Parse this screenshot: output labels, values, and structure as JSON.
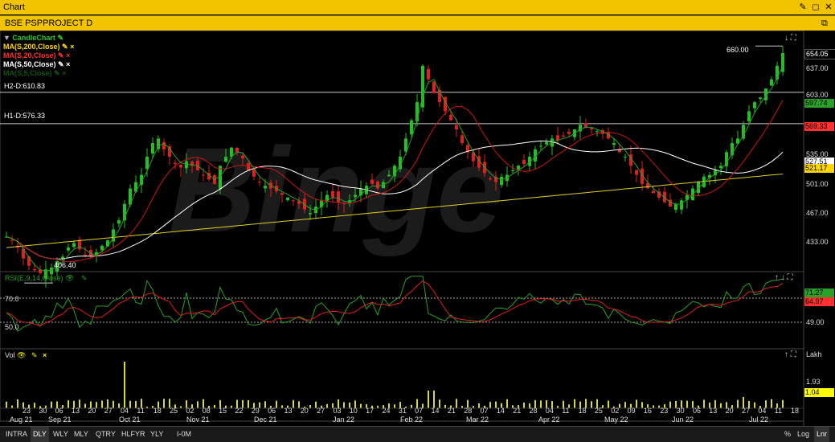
{
  "window": {
    "title": "Chart",
    "controls": [
      "✎",
      "◻",
      "✕"
    ]
  },
  "chart_header": {
    "symbol": "BSE PSPPROJECT D",
    "restore_icon": "⧉"
  },
  "legend": [
    {
      "label": "CandleChart",
      "color": "#2ecc2e"
    },
    {
      "label": "MA(S,200,Close)",
      "color": "#ffd700"
    },
    {
      "label": "MA(S,20,Close)",
      "color": "#ff3030"
    },
    {
      "label": "MA(S,50,Close)",
      "color": "#ffffff"
    },
    {
      "label": "MA(S,5,Close)",
      "color": "#2aa02a"
    }
  ],
  "price_panel": {
    "h2_label": "H2-D:610.83",
    "h1_label": "H1-D:576.33",
    "low_label": "406.40",
    "high_label": "660.00",
    "watermark": "Binge",
    "y_ticks": [
      "637.00",
      "603.00",
      "535.00",
      "501.00",
      "467.00",
      "433.00"
    ],
    "price_boxes": [
      {
        "text": "654.05",
        "color": "#ffffff",
        "bg": "#000000"
      },
      {
        "text": "597.74",
        "color": "#000000",
        "bg": "#2aa02a"
      },
      {
        "text": "569.33",
        "color": "#000000",
        "bg": "#ff3030"
      },
      {
        "text": "527.51",
        "color": "#000000",
        "bg": "#ffffff"
      },
      {
        "text": "521.17",
        "color": "#000000",
        "bg": "#ffd700"
      }
    ]
  },
  "rsi_panel": {
    "label": "RSI(E,9,14,Close)",
    "levels": [
      "70.0",
      "50.0"
    ],
    "y_tick": "49.00",
    "boxes": [
      {
        "text": "71.27",
        "color": "#000000",
        "bg": "#2aa02a"
      },
      {
        "text": "64.97",
        "color": "#000000",
        "bg": "#ff3030"
      }
    ]
  },
  "vol_panel": {
    "label": "Vol",
    "unit": "Lakh",
    "y_tick": "1.93",
    "box": {
      "text": "1.04",
      "color": "#000000",
      "bg": "#ffff00"
    }
  },
  "x_axis": {
    "days": [
      "23",
      "30",
      "06",
      "13",
      "20",
      "27",
      "04",
      "11",
      "18",
      "25",
      "02",
      "08",
      "15",
      "22",
      "29",
      "06",
      "13",
      "20",
      "27",
      "03",
      "10",
      "17",
      "24",
      "31",
      "07",
      "14",
      "21",
      "28",
      "07",
      "14",
      "21",
      "28",
      "04",
      "11",
      "18",
      "25",
      "02",
      "09",
      "16",
      "23",
      "30",
      "06",
      "13",
      "20",
      "27",
      "04",
      "11",
      "18"
    ],
    "months": [
      "Aug 21",
      "Sep 21",
      "Oct 21",
      "Nov 21",
      "Dec 21",
      "Jan 22",
      "Feb 22",
      "Mar 22",
      "Apr 22",
      "May 22",
      "Jun 22",
      "Jul 22"
    ]
  },
  "bottom_bar": {
    "buttons": [
      "INTRA",
      "DLY",
      "WLY",
      "MLY",
      "QTRY",
      "HLFYR",
      "YLY",
      "I-0M"
    ],
    "right": [
      "%",
      "Log",
      "Lnr"
    ]
  },
  "chart_data": {
    "type": "candlestick",
    "title": "BSE PSPPROJECT D",
    "ylim": [
      400,
      665
    ],
    "close_series": [
      452,
      448,
      440,
      428,
      420,
      415,
      412,
      416,
      418,
      425,
      430,
      440,
      445,
      438,
      432,
      430,
      435,
      442,
      448,
      460,
      470,
      488,
      505,
      512,
      520,
      540,
      555,
      560,
      548,
      540,
      532,
      528,
      535,
      530,
      525,
      520,
      515,
      510,
      530,
      540,
      550,
      545,
      538,
      525,
      518,
      512,
      508,
      505,
      502,
      498,
      495,
      492,
      488,
      482,
      478,
      485,
      492,
      498,
      495,
      490,
      488,
      492,
      498,
      505,
      508,
      510,
      505,
      512,
      520,
      530,
      540,
      560,
      580,
      600,
      640,
      625,
      610,
      600,
      590,
      580,
      570,
      555,
      545,
      535,
      528,
      522,
      515,
      512,
      518,
      520,
      525,
      530,
      532,
      540,
      548,
      552,
      556,
      560,
      558,
      562,
      565,
      570,
      575,
      572,
      570,
      568,
      565,
      560,
      555,
      545,
      540,
      530,
      520,
      510,
      505,
      500,
      495,
      490,
      485,
      488,
      492,
      498,
      505,
      512,
      518,
      520,
      525,
      530,
      545,
      555,
      560,
      575,
      590,
      600,
      605,
      615,
      625,
      640,
      654
    ]
  }
}
